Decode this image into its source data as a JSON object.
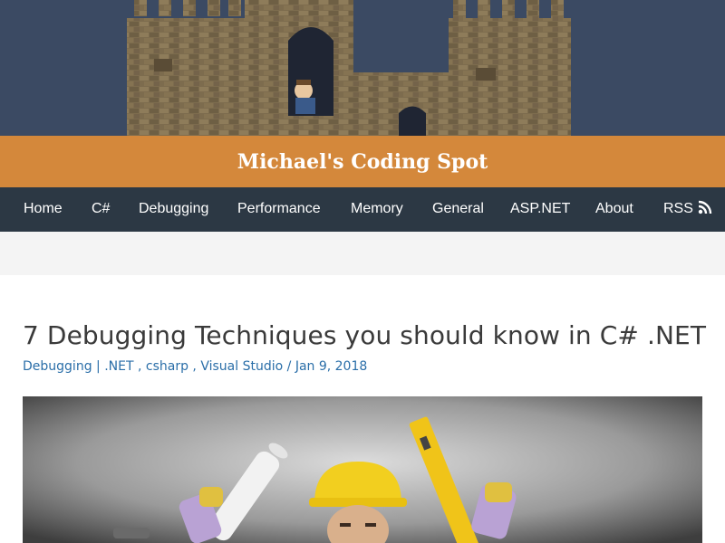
{
  "site": {
    "title": "Michael's Coding Spot"
  },
  "nav": {
    "items": [
      {
        "label": "Home",
        "key": "home"
      },
      {
        "label": "C#",
        "key": "csharp"
      },
      {
        "label": "Debugging",
        "key": "debugging"
      },
      {
        "label": "Performance",
        "key": "performance"
      },
      {
        "label": "Memory",
        "key": "memory"
      },
      {
        "label": "General",
        "key": "general"
      },
      {
        "label": "ASP.NET",
        "key": "aspnet"
      },
      {
        "label": "About",
        "key": "about"
      },
      {
        "label": "RSS",
        "key": "rss",
        "icon": "rss-icon"
      }
    ]
  },
  "post": {
    "title": "7 Debugging Techniques you should know in C# .NET",
    "category": "Debugging",
    "separator": " | ",
    "tags": [
      ".NET",
      "csharp",
      "Visual Studio"
    ],
    "tag_sep": " , ",
    "date_sep": " / ",
    "date": "Jan 9, 2018",
    "hero_image": "construction-worker-hardhat-photo"
  },
  "colors": {
    "banner_bg": "#3b4a63",
    "title_bar": "#d4883b",
    "nav_bg": "#2c3844",
    "link": "#2a6ea8",
    "title_text": "#3a3a3a"
  }
}
